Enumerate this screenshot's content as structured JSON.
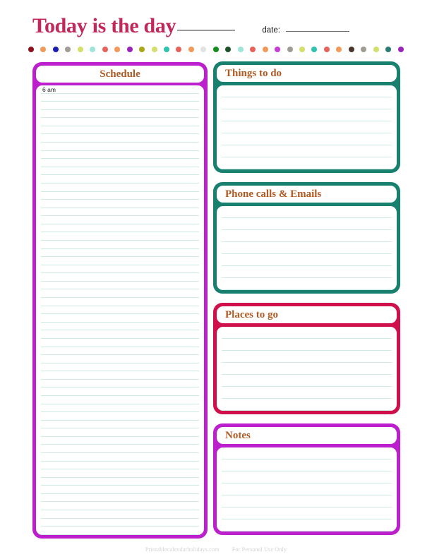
{
  "header": {
    "title": "Today is the day",
    "title_blank": "",
    "date_label": "date:",
    "date_blank": ""
  },
  "decor": {
    "dot_colors": [
      "#8C1220",
      "#F2995A",
      "#1B1BB5",
      "#9E9C93",
      "#D4DE6A",
      "#9CE5D8",
      "#E8625C",
      "#F2995A",
      "#9A24B8",
      "#A8A713",
      "#D4DE6A",
      "#2FC2AE",
      "#E8625C",
      "#F2995A",
      "#E2E2E2",
      "#168E1E",
      "#1E5227",
      "#9CE5D8",
      "#E8625C",
      "#F2995A",
      "#C63BD6",
      "#9E9C93",
      "#D4DE6A",
      "#2FC2AE",
      "#E8625C",
      "#F2995A",
      "#4A352B",
      "#9E9C93",
      "#D4DE6A",
      "#2A7C73",
      "#9A24B8"
    ]
  },
  "panels": {
    "schedule": {
      "title": "Schedule",
      "first_time_label": "6 am",
      "border_color": "#BB20CC",
      "line_count": 55
    },
    "things_to_do": {
      "title": "Things to do",
      "border_color": "#17806E",
      "line_count": 7
    },
    "phone_calls": {
      "title": "Phone calls & Emails",
      "border_color": "#17806E",
      "line_count": 7
    },
    "places_to_go": {
      "title": "Places to go",
      "border_color": "#D0104A",
      "line_count": 7
    },
    "notes": {
      "title": "Notes",
      "border_color": "#BB20CC",
      "line_count": 7
    }
  },
  "footer": {
    "site": "Printablecalendarholidays.com",
    "usage": "For Personal Use Only"
  }
}
